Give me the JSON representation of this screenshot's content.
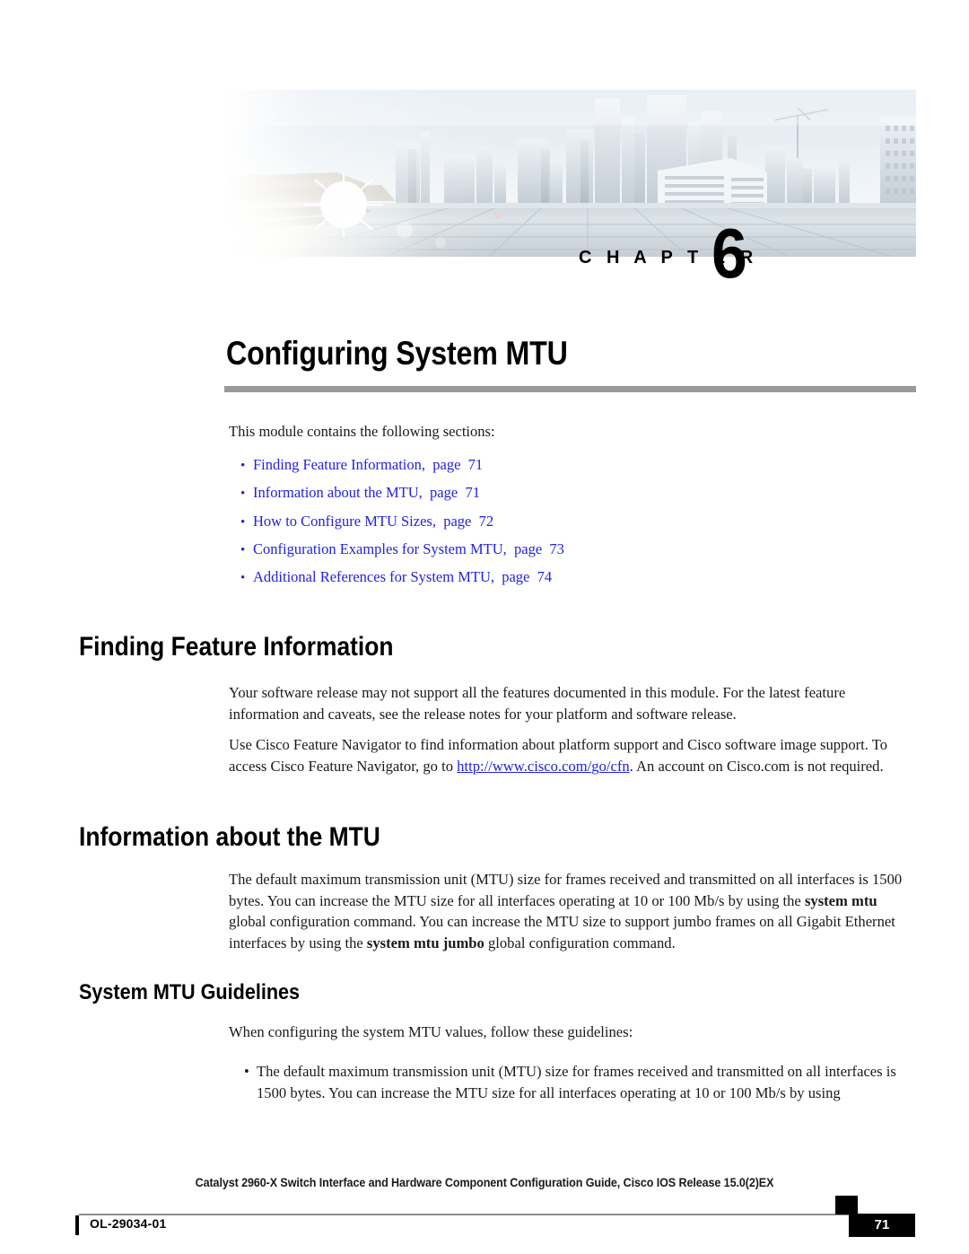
{
  "banner": {
    "alt": "city-skyline-rooftop-photo"
  },
  "chapter": {
    "label": "C H A P T E R",
    "number": "6",
    "title": "Configuring System MTU"
  },
  "intro": {
    "text": "This module contains the following sections:"
  },
  "toc": {
    "bullet": "•",
    "items": [
      {
        "label": "Finding Feature Information,",
        "page": "  page  71"
      },
      {
        "label": "Information about the MTU,",
        "page": "  page  71"
      },
      {
        "label": "How to Configure MTU Sizes,",
        "page": "  page  72"
      },
      {
        "label": "Configuration Examples for System MTU,",
        "page": "  page  73"
      },
      {
        "label": "Additional References for System MTU,",
        "page": "  page  74"
      }
    ]
  },
  "sections": {
    "finding_feature_information": {
      "heading": "Finding Feature Information",
      "p1": "Your software release may not support all the features documented in this module. For the latest feature information and caveats, see the release notes for your platform and software release.",
      "p2_before": "Use Cisco Feature Navigator to find information about platform support and Cisco software image support. To access Cisco Feature Navigator, go to ",
      "p2_link": "http://www.cisco.com/go/cfn",
      "p2_after": ". An account on Cisco.com is not required."
    },
    "information_about_the_mtu": {
      "heading": "Information about the MTU",
      "p1_a": "The default maximum transmission unit (MTU) size for frames received and transmitted on all interfaces is 1500 bytes. You can increase the MTU size for all interfaces operating at 10 or 100 Mb/s by using the ",
      "p1_b": "system mtu",
      "p1_c": " global configuration command. You can increase the MTU size to support jumbo frames on all Gigabit Ethernet interfaces by using the ",
      "p1_d": "system mtu jumbo",
      "p1_e": " global configuration command."
    },
    "system_mtu_guidelines": {
      "heading": "System MTU Guidelines",
      "intro": "When configuring the system MTU values, follow these guidelines:",
      "bullet": "•",
      "items": [
        "The default maximum transmission unit (MTU) size for frames received and transmitted on all interfaces is 1500 bytes. You can increase the MTU size for all interfaces operating at 10 or 100 Mb/s by using"
      ]
    }
  },
  "footer": {
    "title": "Catalyst 2960-X Switch Interface and Hardware Component Configuration Guide, Cisco IOS Release 15.0(2)EX",
    "doc_id": "OL-29034-01",
    "page_number": "71"
  },
  "colors": {
    "link": "#2222dd",
    "rule": "#9a9a9a",
    "footer_rule": "#8c8c8c",
    "text": "#1a1a1a"
  }
}
